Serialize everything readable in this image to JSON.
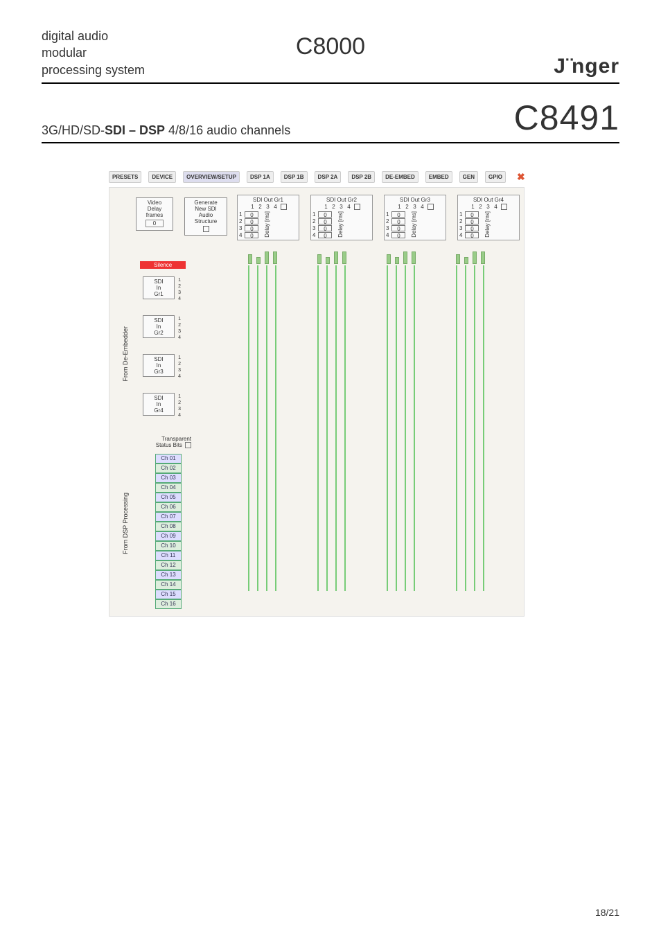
{
  "header": {
    "line1": "digital audio",
    "line2": "modular",
    "line3": "processing system",
    "center": "C8000",
    "brand_left": "J",
    "brand_right": "nger"
  },
  "subhead": {
    "prefix": "3G/HD/SD-",
    "bold": "SDI – DSP",
    "suffix": " 4/8/16 audio channels",
    "code": "C8491"
  },
  "tabs": {
    "items": [
      "PRESETS",
      "DEVICE",
      "OVERVIEW/SETUP",
      "DSP 1A",
      "DSP 1B",
      "DSP 2A",
      "DSP 2B",
      "DE-EMBED",
      "EMBED",
      "GEN",
      "GPIO"
    ],
    "active_index": 2
  },
  "video_delay": {
    "label1": "Video",
    "label2": "Delay",
    "label3": "frames",
    "value": "0"
  },
  "gen_block": {
    "l1": "Generate",
    "l2": "New SDI",
    "l3": "Audio",
    "l4": "Structure"
  },
  "out_groups": [
    {
      "title": "SDI Out Gr1",
      "cols": [
        "1",
        "2",
        "3",
        "4"
      ],
      "rows": [
        "1",
        "2",
        "3",
        "4"
      ],
      "vals": [
        "0",
        "0",
        "0",
        "0"
      ],
      "dlabel": "Delay [ms]"
    },
    {
      "title": "SDI Out Gr2",
      "cols": [
        "1",
        "2",
        "3",
        "4"
      ],
      "rows": [
        "1",
        "2",
        "3",
        "4"
      ],
      "vals": [
        "0",
        "0",
        "0",
        "0"
      ],
      "dlabel": "Delay [ms]"
    },
    {
      "title": "SDI Out Gr3",
      "cols": [
        "1",
        "2",
        "3",
        "4"
      ],
      "rows": [
        "1",
        "2",
        "3",
        "4"
      ],
      "vals": [
        "0",
        "0",
        "0",
        "0"
      ],
      "dlabel": "Delay [ms]"
    },
    {
      "title": "SDI Out Gr4",
      "cols": [
        "1",
        "2",
        "3",
        "4"
      ],
      "rows": [
        "1",
        "2",
        "3",
        "4"
      ],
      "vals": [
        "0",
        "0",
        "0",
        "0"
      ],
      "dlabel": "Delay [ms]"
    }
  ],
  "silence": "Silence",
  "side_labels": {
    "deembedder": "From De-Embedder",
    "dsp": "From DSP Processing"
  },
  "sdi_in_groups": [
    {
      "l1": "SDI",
      "l2": "In",
      "l3": "Gr1",
      "nums": [
        "1",
        "2",
        "3",
        "4"
      ]
    },
    {
      "l1": "SDI",
      "l2": "In",
      "l3": "Gr2",
      "nums": [
        "1",
        "2",
        "3",
        "4"
      ]
    },
    {
      "l1": "SDI",
      "l2": "In",
      "l3": "Gr3",
      "nums": [
        "1",
        "2",
        "3",
        "4"
      ]
    },
    {
      "l1": "SDI",
      "l2": "In",
      "l3": "Gr4",
      "nums": [
        "1",
        "2",
        "3",
        "4"
      ]
    }
  ],
  "tsb": {
    "l1": "Transparent",
    "l2": "Status Bits"
  },
  "channels": [
    "Ch 01",
    "Ch 02",
    "Ch 03",
    "Ch 04",
    "Ch 05",
    "Ch 06",
    "Ch 07",
    "Ch 08",
    "Ch 09",
    "Ch 10",
    "Ch 11",
    "Ch 12",
    "Ch 13",
    "Ch 14",
    "Ch 15",
    "Ch 16"
  ],
  "footer": "18/21"
}
